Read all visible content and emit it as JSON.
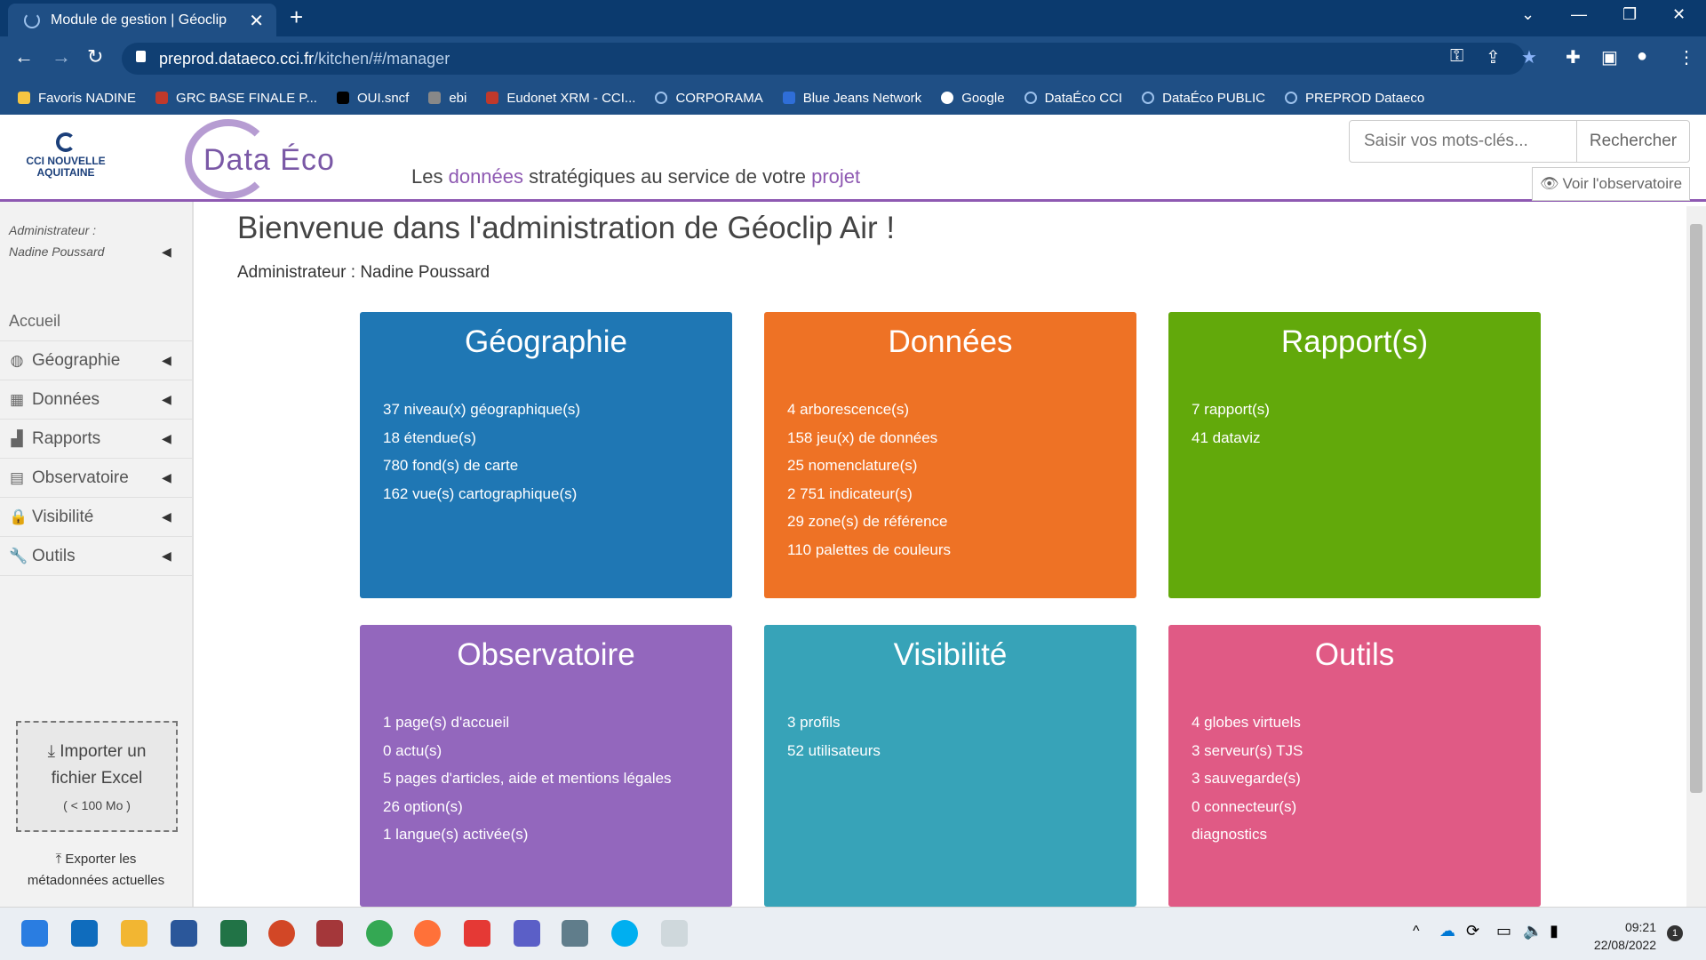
{
  "browser": {
    "tab_title": "Module de gestion | Géoclip",
    "new_tab": "+",
    "url_host": "preprod.dataeco.cci.fr",
    "url_path": "/kitchen/#/manager",
    "bookmarks": [
      "Favoris NADINE",
      "GRC BASE FINALE P...",
      "OUI.sncf",
      "ebi",
      "Eudonet XRM - CCI...",
      "CORPORAMA",
      "Blue Jeans Network",
      "Google",
      "DataÉco CCI",
      "DataÉco PUBLIC",
      "PREPROD Dataeco"
    ]
  },
  "header": {
    "cci_logo": "CCI NOUVELLE AQUITAINE",
    "logo_text": "Data Éco",
    "tagline_1": "Les ",
    "tagline_hl1": "données",
    "tagline_2": " stratégiques au service de votre ",
    "tagline_hl2": "projet",
    "search_placeholder": "Saisir vos mots-clés...",
    "search_button": "Rechercher",
    "observatoire_button": "Voir l'observatoire"
  },
  "sidebar": {
    "admin_label": "Administrateur :",
    "admin_name": "Nadine Poussard",
    "home": "Accueil",
    "items": [
      "Géographie",
      "Données",
      "Rapports",
      "Observatoire",
      "Visibilité",
      "Outils"
    ],
    "import_line1": "Importer un",
    "import_line2": "fichier Excel",
    "import_note": "( < 100 Mo )",
    "export_line1": "Exporter les",
    "export_line2": "métadonnées actuelles"
  },
  "main": {
    "title": "Bienvenue dans l'administration de Géoclip Air !",
    "subtitle": "Administrateur : Nadine Poussard",
    "cards": [
      {
        "title": "Géographie",
        "color": "#1f77b4",
        "lines": [
          "37 niveau(x) géographique(s)",
          "18 étendue(s)",
          "780 fond(s) de carte",
          "162 vue(s) cartographique(s)"
        ]
      },
      {
        "title": "Données",
        "color": "#ee7225",
        "lines": [
          "4 arborescence(s)",
          "158 jeu(x) de données",
          "25 nomenclature(s)",
          "2 751 indicateur(s)",
          "29 zone(s) de référence",
          "110 palettes de couleurs"
        ]
      },
      {
        "title": "Rapport(s)",
        "color": "#62a90b",
        "lines": [
          "7 rapport(s)",
          "41 dataviz"
        ]
      },
      {
        "title": "Observatoire",
        "color": "#9367bd",
        "lines": [
          "1 page(s) d'accueil",
          "0 actu(s)",
          "5 pages d'articles, aide et mentions légales",
          "26 option(s)",
          "1 langue(s) activée(s)"
        ]
      },
      {
        "title": "Visibilité",
        "color": "#37a3b8",
        "lines": [
          "3 profils",
          "52  utilisateurs"
        ]
      },
      {
        "title": "Outils",
        "color": "#e05a85",
        "lines": [
          "4 globes virtuels",
          "3 serveur(s) TJS",
          "3 sauvegarde(s)",
          "0 connecteur(s)",
          "diagnostics"
        ]
      }
    ]
  },
  "taskbar": {
    "time": "09:21",
    "date": "22/08/2022",
    "badge": "1"
  }
}
